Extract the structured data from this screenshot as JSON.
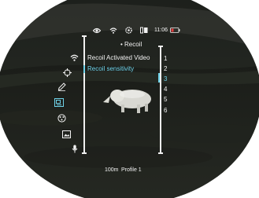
{
  "status_bar": {
    "icons": [
      "eye-icon",
      "wifi-icon",
      "gear-icon",
      "map-marker-icon",
      "battery-icon"
    ],
    "time": "11:06",
    "battery_color": "#e23b3b"
  },
  "menu": {
    "title": "• Recoil",
    "left_icons": [
      "wifi-icon",
      "crosshair-icon",
      "pencil-icon",
      "pip-icon",
      "palette-icon",
      "image-icon",
      "microphone-icon"
    ],
    "items": [
      {
        "label": "Recoil Activated Video",
        "selected": false
      },
      {
        "label": "Recoil sensitivity",
        "selected": true
      }
    ],
    "levels": [
      "1",
      "2",
      "3",
      "4",
      "5",
      "6"
    ],
    "selected_level": "3"
  },
  "footer": {
    "range": "100m",
    "profile": "Profile 1"
  },
  "colors": {
    "accent": "#6fd3ea",
    "text": "#f2f2f2"
  }
}
